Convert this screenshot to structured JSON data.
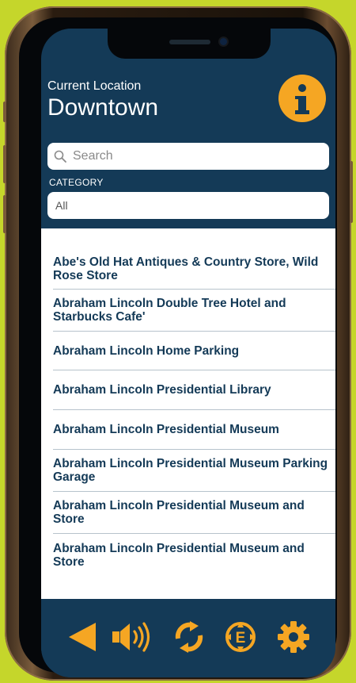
{
  "header": {
    "location_label": "Current Location",
    "location_name": "Downtown",
    "info_icon": "info-icon"
  },
  "search": {
    "placeholder": "Search",
    "value": ""
  },
  "category": {
    "label": "CATEGORY",
    "selected": "All"
  },
  "places": [
    "Abe's Old Hat Antiques & Country Store, Wild Rose Store",
    "Abraham Lincoln Double Tree Hotel and Starbucks Cafe'",
    "Abraham Lincoln Home Parking",
    "Abraham Lincoln Presidential Library",
    "Abraham Lincoln Presidential Museum",
    "Abraham Lincoln Presidential Museum Parking Garage",
    "Abraham Lincoln Presidential Museum and Store",
    "Abraham Lincoln Presidential Museum and Store"
  ],
  "toolbar": {
    "icons": [
      "back-arrow-icon",
      "speaker-icon",
      "refresh-icon",
      "explore-icon",
      "settings-icon"
    ]
  },
  "colors": {
    "brand_navy": "#143a57",
    "accent_orange": "#f5a623",
    "background": "#c5d62b"
  }
}
